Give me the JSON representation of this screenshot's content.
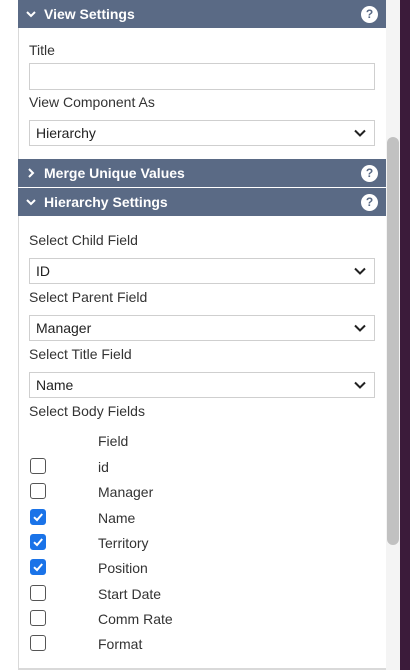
{
  "view_settings": {
    "header": "View Settings",
    "help": "?",
    "title_label": "Title",
    "title_value": "",
    "view_as_label": "View Component As",
    "view_as_value": "Hierarchy"
  },
  "merge_unique": {
    "header": "Merge Unique Values",
    "help": "?"
  },
  "hierarchy": {
    "header": "Hierarchy Settings",
    "help": "?",
    "child_label": "Select Child Field",
    "child_value": "ID",
    "parent_label": "Select Parent Field",
    "parent_value": "Manager",
    "title_field_label": "Select Title Field",
    "title_field_value": "Name",
    "body_label": "Select Body Fields",
    "field_column": "Field",
    "fields": [
      {
        "name": "id",
        "checked": false
      },
      {
        "name": "Manager",
        "checked": false
      },
      {
        "name": "Name",
        "checked": true
      },
      {
        "name": "Territory",
        "checked": true
      },
      {
        "name": "Position",
        "checked": true
      },
      {
        "name": "Start Date",
        "checked": false
      },
      {
        "name": "Comm Rate",
        "checked": false
      },
      {
        "name": "Format",
        "checked": false
      }
    ]
  },
  "colors": {
    "header_bg": "#5a6a85",
    "checkbox_checked": "#1a73e8",
    "sidebar_purple": "#3b1b3a"
  }
}
